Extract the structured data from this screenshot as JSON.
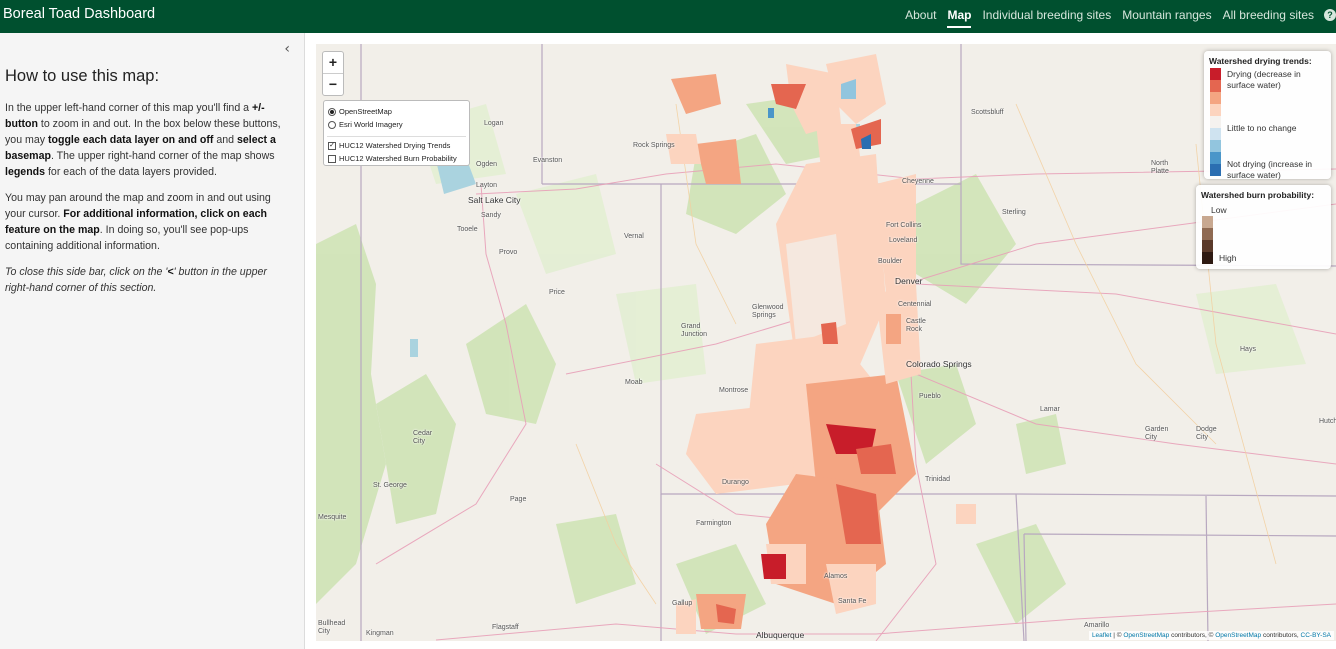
{
  "navbar": {
    "brand": "Boreal Toad Dashboard",
    "links": [
      "About",
      "Map",
      "Individual breeding sites",
      "Mountain ranges",
      "All breeding sites"
    ],
    "active": "Map",
    "help_glyph": "?"
  },
  "sidebar": {
    "collapse_glyph": "‹",
    "title": "How to use this map:",
    "p1": [
      "In the upper left-hand corner of this map you'll find a ",
      "+/- button",
      " to zoom in and out. In the box below these buttons, you may ",
      "toggle each data layer on and off",
      " and ",
      "select a basemap",
      ". The upper right-hand corner of the map shows ",
      "legends",
      " for each of the data layers provided."
    ],
    "p2": [
      "You may pan around the map and zoom in and out using your cursor. ",
      "For additional information, click on each feature on the map",
      ". In doing so, you'll see pop-ups containing additional information."
    ],
    "p3": [
      "To close this side bar, click on the '",
      "<",
      "' button in the upper right-hand corner of this section."
    ]
  },
  "map": {
    "zoom_in": "+",
    "zoom_out": "−",
    "basemaps": [
      {
        "label": "OpenStreetMap",
        "selected": true
      },
      {
        "label": "Esri World Imagery",
        "selected": false
      }
    ],
    "overlays": [
      {
        "label": "HUC12 Watershed Drying Trends",
        "checked": true,
        "check_glyph": "✓"
      },
      {
        "label": "HUC12 Watershed Burn Probability",
        "checked": false,
        "check_glyph": ""
      }
    ],
    "cities": [
      {
        "name": "Logan"
      },
      {
        "name": "Ogden"
      },
      {
        "name": "Evanston"
      },
      {
        "name": "Rock Springs"
      },
      {
        "name": "Layton"
      },
      {
        "name": "Salt Lake City"
      },
      {
        "name": "Sandy"
      },
      {
        "name": "Tooele"
      },
      {
        "name": "Provo"
      },
      {
        "name": "Vernal"
      },
      {
        "name": "Price"
      },
      {
        "name": "Grand Junction"
      },
      {
        "name": "Glenwood Springs"
      },
      {
        "name": "Moab"
      },
      {
        "name": "Montrose"
      },
      {
        "name": "Cedar City"
      },
      {
        "name": "St. George"
      },
      {
        "name": "Mesquite"
      },
      {
        "name": "Page"
      },
      {
        "name": "Durango"
      },
      {
        "name": "Farmington"
      },
      {
        "name": "Gallup"
      },
      {
        "name": "Flagstaff"
      },
      {
        "name": "Kingman"
      },
      {
        "name": "Bullhead City"
      },
      {
        "name": "Albuquerque"
      },
      {
        "name": "Santa Fe"
      },
      {
        "name": "Alamos"
      },
      {
        "name": "Trinidad"
      },
      {
        "name": "Pueblo"
      },
      {
        "name": "Colorado Springs"
      },
      {
        "name": "Castle Rock"
      },
      {
        "name": "Denver"
      },
      {
        "name": "Centennial"
      },
      {
        "name": "Boulder"
      },
      {
        "name": "Loveland"
      },
      {
        "name": "Fort Collins"
      },
      {
        "name": "Cheyenne"
      },
      {
        "name": "Scottsbluff"
      },
      {
        "name": "North Platte"
      },
      {
        "name": "Sterling"
      },
      {
        "name": "Hays"
      },
      {
        "name": "Lamar"
      },
      {
        "name": "Garden City"
      },
      {
        "name": "Dodge City"
      },
      {
        "name": "Hutch"
      },
      {
        "name": "Amarillo"
      }
    ],
    "attribution": {
      "leaflet": "Leaflet",
      "sep1": " | © ",
      "osm1": "OpenStreetMap",
      "mid": " contributors, © ",
      "osm2": "OpenStreetMap",
      "mid2": " contributors, ",
      "license": "CC-BY-SA"
    }
  },
  "legend_drying": {
    "title": "Watershed drying trends:",
    "colors": [
      "#c81d2a",
      "#e46650",
      "#f4a582",
      "#fcd4bf",
      "#f5f2ef",
      "#cfe3f0",
      "#92c5de",
      "#4a96c9",
      "#2b6eb1"
    ],
    "labels": {
      "top": "Drying (decrease in surface water)",
      "mid": "Little to no change",
      "bottom": "Not drying (increase in surface water)"
    }
  },
  "legend_burn": {
    "title": "Watershed burn probability:",
    "colors": [
      "#c8a890",
      "#8f6a52",
      "#5a3a2a",
      "#2e1a12"
    ],
    "labels": {
      "low": "Low",
      "high": "High"
    }
  },
  "colors": {
    "navbar": "#00502f",
    "map_land": "#f2efe9",
    "sidebar": "#f5f5f5"
  }
}
